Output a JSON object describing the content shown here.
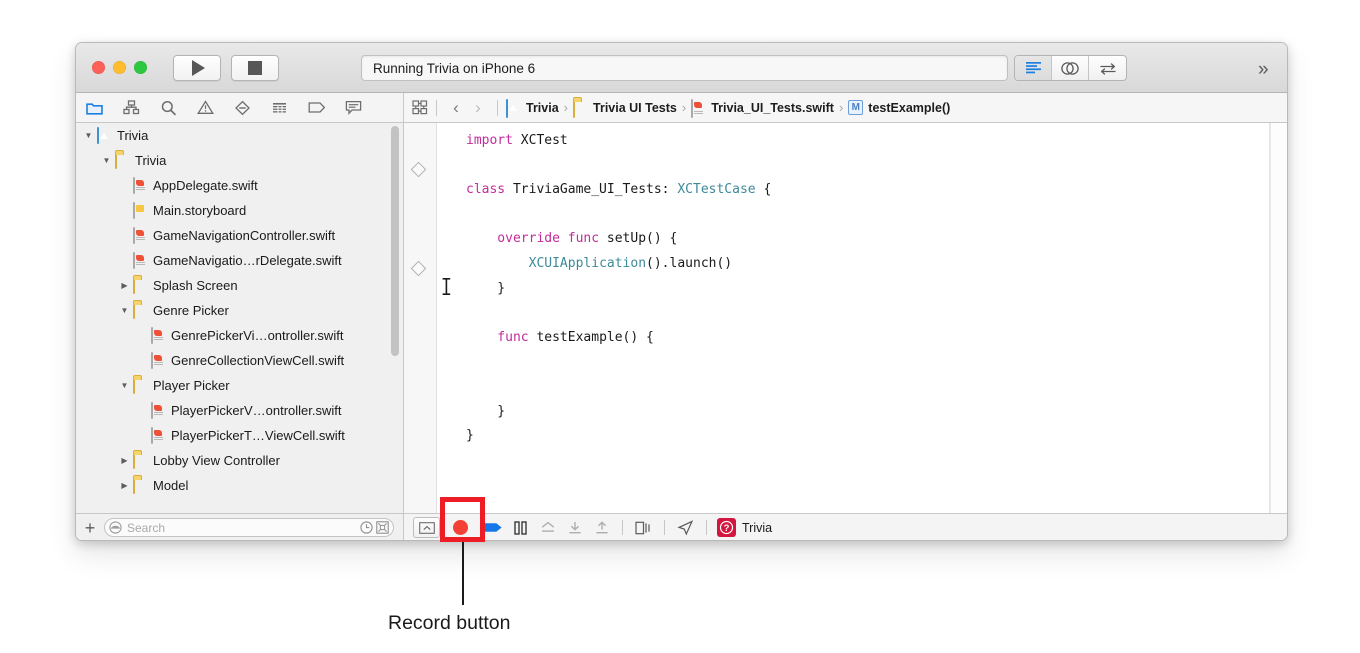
{
  "window": {
    "traffic_lights": [
      "close",
      "minimize",
      "maximize"
    ],
    "run_button": "run-icon",
    "stop_button": "stop-icon",
    "scheme_status": "Running Trivia on iPhone 6",
    "right_segments": [
      "standard-editor-icon",
      "assistant-editor-icon",
      "version-editor-icon"
    ],
    "expand_chevron": "»"
  },
  "navigator_toolbar": {
    "icons": [
      {
        "name": "project-navigator-icon",
        "active": true
      },
      {
        "name": "symbol-navigator-icon",
        "active": false
      },
      {
        "name": "find-navigator-icon",
        "active": false
      },
      {
        "name": "issue-navigator-icon",
        "active": false
      },
      {
        "name": "test-navigator-icon",
        "active": false
      },
      {
        "name": "debug-navigator-icon",
        "active": false
      },
      {
        "name": "breakpoint-navigator-icon",
        "active": false
      },
      {
        "name": "report-navigator-icon",
        "active": false
      }
    ]
  },
  "jump_bar": {
    "related_items_icon": "related-items-icon",
    "back_arrow": "‹",
    "forward_arrow": "›",
    "separator": "›",
    "breadcrumbs": [
      {
        "label": "Trivia",
        "icon": "project-icon"
      },
      {
        "label": "Trivia UI Tests",
        "icon": "folder-icon"
      },
      {
        "label": "Trivia_UI_Tests.swift",
        "icon": "swift-file-icon"
      },
      {
        "label": "testExample()",
        "icon": "method-icon",
        "badge": "M"
      }
    ]
  },
  "navigator": {
    "tree": [
      {
        "label": "Trivia",
        "indent": 0,
        "disclosure": "open",
        "icon": "project-icon"
      },
      {
        "label": "Trivia",
        "indent": 1,
        "disclosure": "open",
        "icon": "folder-icon"
      },
      {
        "label": "AppDelegate.swift",
        "indent": 2,
        "disclosure": "none",
        "icon": "swift-file-icon"
      },
      {
        "label": "Main.storyboard",
        "indent": 2,
        "disclosure": "none",
        "icon": "storyboard-file-icon"
      },
      {
        "label": "GameNavigationController.swift",
        "indent": 2,
        "disclosure": "none",
        "icon": "swift-file-icon"
      },
      {
        "label": "GameNavigatio…rDelegate.swift",
        "indent": 2,
        "disclosure": "none",
        "icon": "swift-file-icon"
      },
      {
        "label": "Splash Screen",
        "indent": 2,
        "disclosure": "closed",
        "icon": "folder-icon"
      },
      {
        "label": "Genre Picker",
        "indent": 2,
        "disclosure": "open",
        "icon": "folder-icon"
      },
      {
        "label": "GenrePickerVi…ontroller.swift",
        "indent": 3,
        "disclosure": "none",
        "icon": "swift-file-icon"
      },
      {
        "label": "GenreCollectionViewCell.swift",
        "indent": 3,
        "disclosure": "none",
        "icon": "swift-file-icon"
      },
      {
        "label": "Player Picker",
        "indent": 2,
        "disclosure": "open",
        "icon": "folder-icon"
      },
      {
        "label": "PlayerPickerV…ontroller.swift",
        "indent": 3,
        "disclosure": "none",
        "icon": "swift-file-icon"
      },
      {
        "label": "PlayerPickerT…ViewCell.swift",
        "indent": 3,
        "disclosure": "none",
        "icon": "swift-file-icon"
      },
      {
        "label": "Lobby View Controller",
        "indent": 2,
        "disclosure": "closed",
        "icon": "folder-icon"
      },
      {
        "label": "Model",
        "indent": 2,
        "disclosure": "closed",
        "icon": "folder-icon"
      }
    ],
    "scrollbar": "vertical-scrollbar"
  },
  "editor": {
    "gutter_markers": [
      "test-diamond-marker",
      "test-diamond-marker"
    ],
    "text_cursor": "i-beam-cursor",
    "code_lines": [
      [
        {
          "t": "import ",
          "c": "kw"
        },
        {
          "t": "XCTest",
          "c": "pln"
        }
      ],
      [],
      [
        {
          "t": "class ",
          "c": "kw"
        },
        {
          "t": "TriviaGame_UI_Tests: ",
          "c": "pln"
        },
        {
          "t": "XCTestCase ",
          "c": "typ"
        },
        {
          "t": "{",
          "c": "pln"
        }
      ],
      [],
      [
        {
          "t": "    override func ",
          "c": "kw"
        },
        {
          "t": "setUp() {",
          "c": "pln"
        }
      ],
      [
        {
          "t": "        ",
          "c": "pln"
        },
        {
          "t": "XCUIApplication",
          "c": "typ"
        },
        {
          "t": "().launch()",
          "c": "pln"
        }
      ],
      [
        {
          "t": "    }",
          "c": "pln"
        }
      ],
      [],
      [
        {
          "t": "    func ",
          "c": "kw"
        },
        {
          "t": "testExample() {",
          "c": "pln"
        }
      ],
      [],
      [],
      [
        {
          "t": "    }",
          "c": "pln"
        }
      ],
      [
        {
          "t": "}",
          "c": "pln"
        }
      ]
    ]
  },
  "filter_bar": {
    "add_label": "+",
    "search_placeholder": "Search",
    "filter_icon": "filter-scope-icon",
    "recents_icon": "clock-recents-icon",
    "scope_icon": "scope-filter-icon"
  },
  "debug_bar": {
    "buttons": [
      {
        "name": "hide-debug-area-button",
        "icon": "debug-area-icon"
      },
      {
        "name": "record-ui-test-button",
        "icon": "record-dot-icon",
        "highlighted": true
      },
      {
        "name": "continue-button",
        "icon": "continue-arrow-icon"
      },
      {
        "name": "pause-button",
        "icon": "pause-icon"
      },
      {
        "name": "step-over-button",
        "icon": "step-over-icon"
      },
      {
        "name": "step-into-button",
        "icon": "step-into-icon"
      },
      {
        "name": "step-out-button",
        "icon": "step-out-icon"
      },
      {
        "name": "view-debugging-button",
        "icon": "view-hierarchy-icon"
      },
      {
        "name": "simulate-location-button",
        "icon": "location-arrow-icon"
      }
    ],
    "process_name": "Trivia",
    "process_icon": "trivia-app-icon",
    "process_icon_color": "#d3163f"
  },
  "annotation": {
    "label": "Record button",
    "color": "#ee1c25",
    "leader_color": "#1a1a1a"
  }
}
